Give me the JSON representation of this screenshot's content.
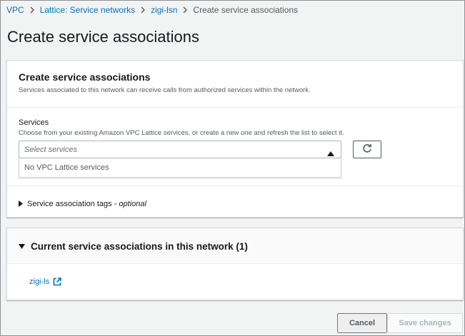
{
  "breadcrumb": {
    "items": [
      "VPC",
      "Lattice: Service networks",
      "zigi-lsn"
    ],
    "current": "Create service associations"
  },
  "page": {
    "title": "Create service associations"
  },
  "form": {
    "header_title": "Create service associations",
    "header_description": "Services associated to this network can receive calls from authorized services within the network.",
    "services_label": "Services",
    "services_description": "Choose from your existing Amazon VPC Lattice services, or create a new one and refresh the list to select it.",
    "select_placeholder": "Select services",
    "dropdown_empty": "No VPC Lattice services",
    "tags_label": "Service association tags",
    "tags_optional": " - optional"
  },
  "current": {
    "title": "Current service associations in this network (1)",
    "items": [
      "zigi-ls"
    ]
  },
  "actions": {
    "cancel": "Cancel",
    "save": "Save changes"
  },
  "icons": {
    "breadcrumb_separator": "chevron-right-icon",
    "select_caret": "caret-up-icon",
    "refresh": "refresh-icon",
    "tags_toggle": "caret-right-icon",
    "current_toggle": "caret-down-icon",
    "external": "external-link-icon"
  },
  "colors": {
    "link": "#0073bb",
    "background": "#f2f3f3",
    "text": "#16191f",
    "muted": "#545b64"
  }
}
